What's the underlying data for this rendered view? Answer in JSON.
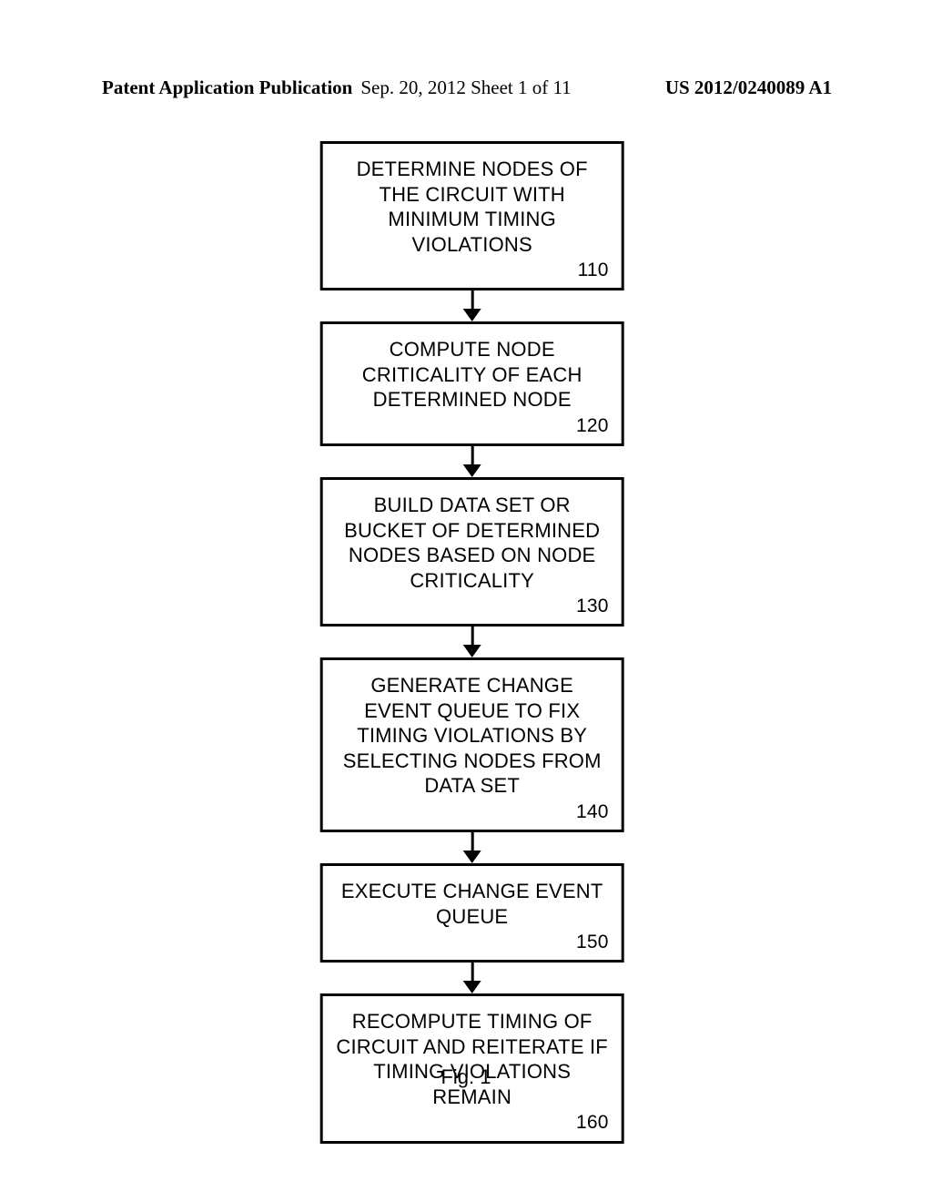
{
  "header": {
    "left": "Patent Application Publication",
    "center": "Sep. 20, 2012  Sheet 1 of 11",
    "right": "US 2012/0240089 A1"
  },
  "flowchart": {
    "boxes": [
      {
        "text": "DETERMINE NODES OF THE CIRCUIT WITH MINIMUM TIMING VIOLATIONS",
        "num": "110"
      },
      {
        "text": "COMPUTE NODE CRITICALITY OF EACH DETERMINED NODE",
        "num": "120"
      },
      {
        "text": "BUILD DATA SET OR BUCKET OF DETERMINED NODES BASED ON NODE CRITICALITY",
        "num": "130"
      },
      {
        "text": "GENERATE CHANGE EVENT QUEUE TO FIX TIMING VIOLATIONS BY SELECTING NODES FROM DATA SET",
        "num": "140"
      },
      {
        "text": "EXECUTE CHANGE EVENT QUEUE",
        "num": "150"
      },
      {
        "text": "RECOMPUTE TIMING OF CIRCUIT AND REITERATE IF TIMING VIOLATIONS REMAIN",
        "num": "160"
      }
    ]
  },
  "figure_label": "Fig. 1"
}
